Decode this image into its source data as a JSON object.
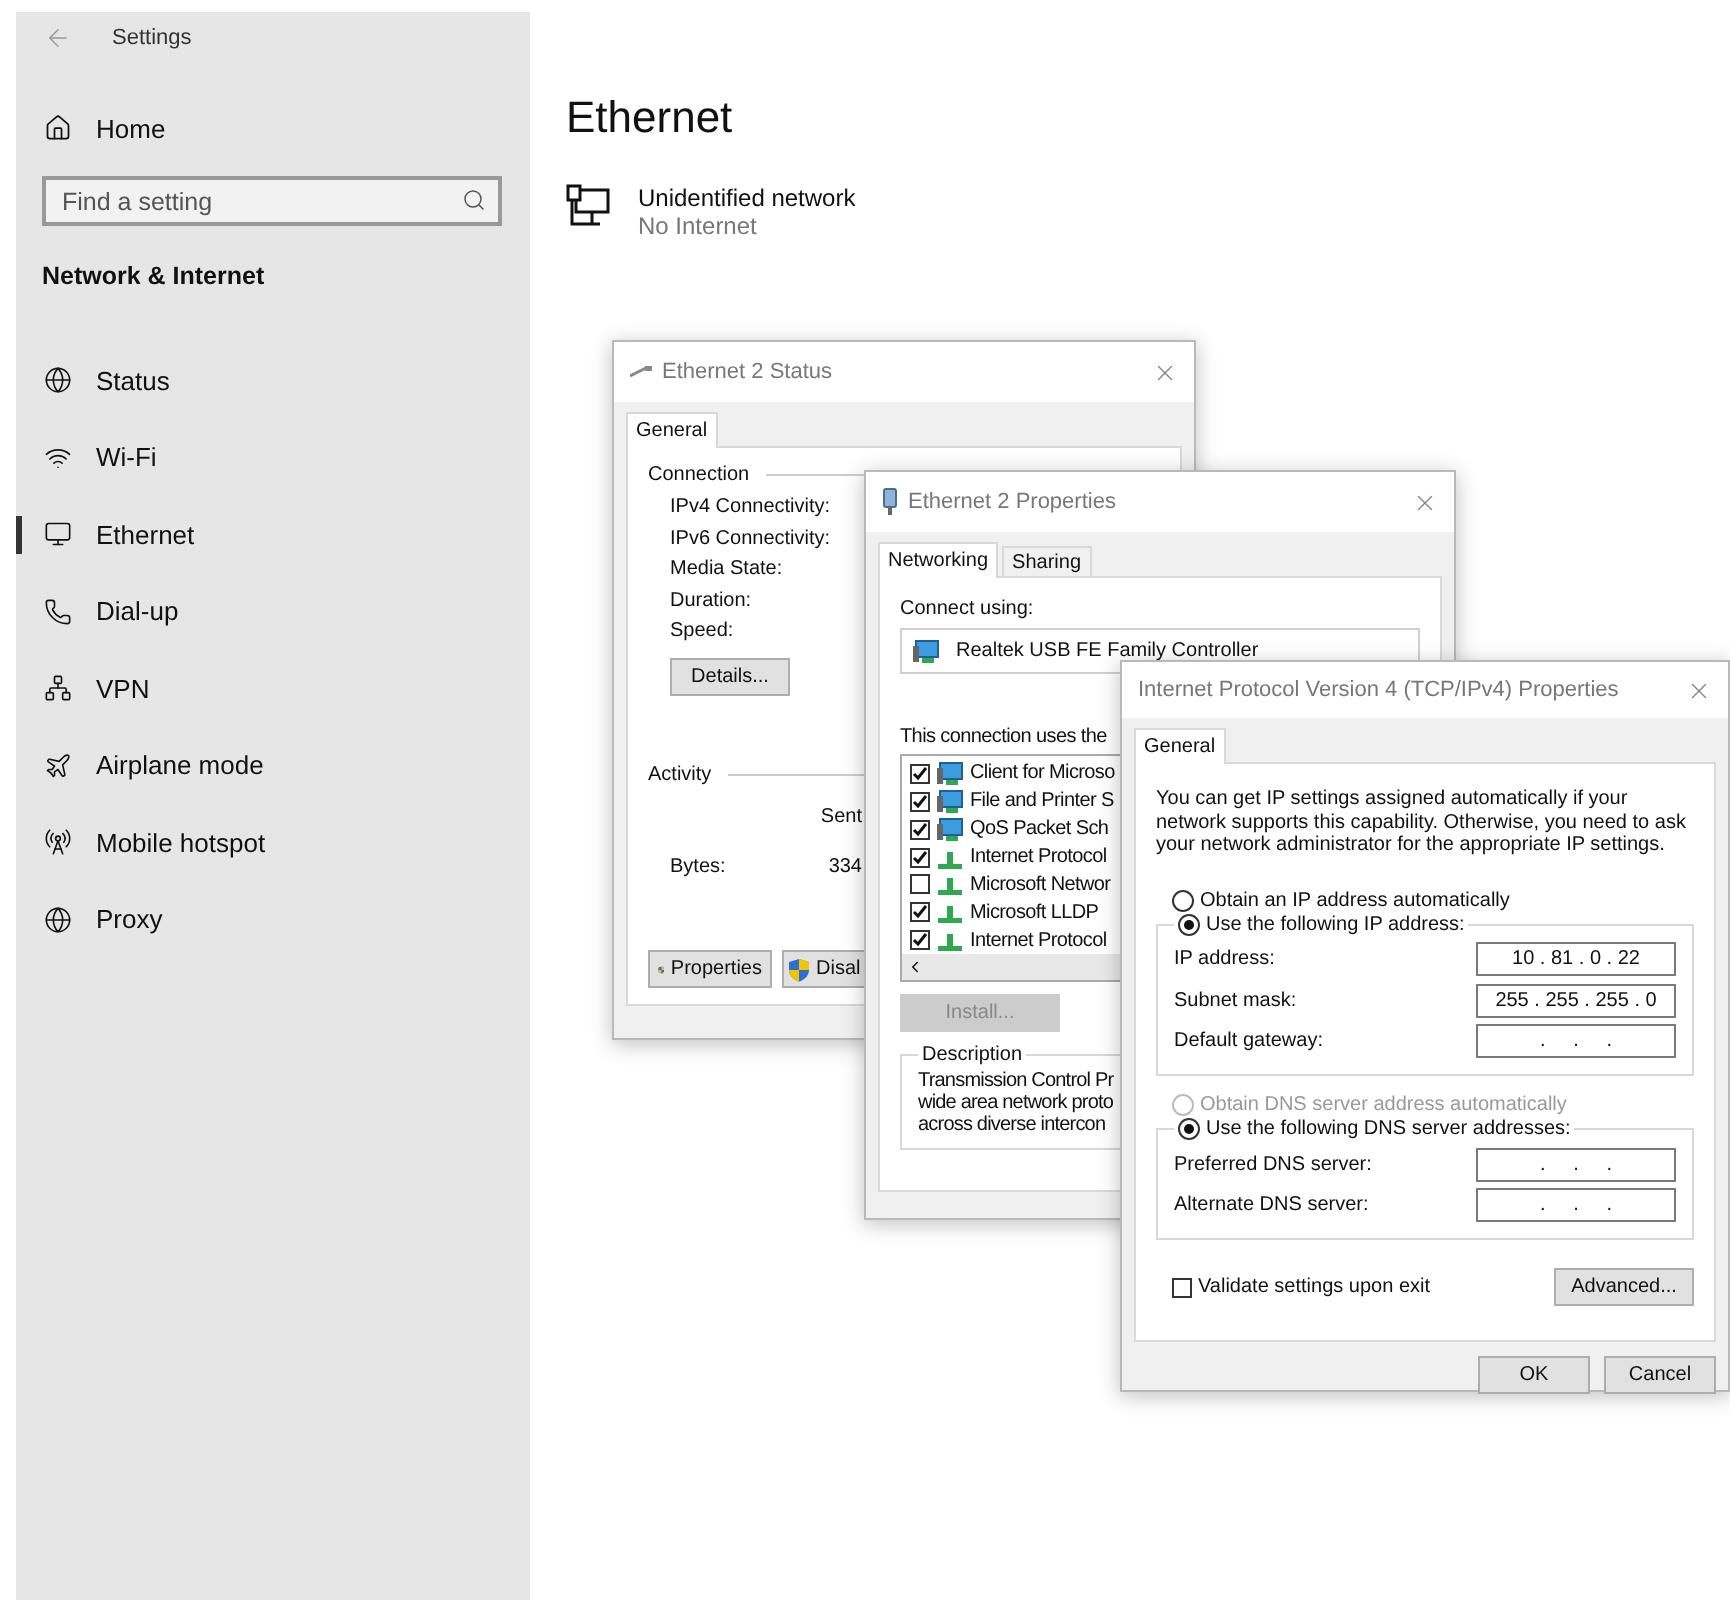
{
  "sidebar": {
    "title": "Settings",
    "home": "Home",
    "search": {
      "placeholder": "Find a setting"
    },
    "section": "Network & Internet",
    "items": [
      {
        "label": "Status",
        "selected": false
      },
      {
        "label": "Wi-Fi",
        "selected": false
      },
      {
        "label": "Ethernet",
        "selected": true
      },
      {
        "label": "Dial-up",
        "selected": false
      },
      {
        "label": "VPN",
        "selected": false
      },
      {
        "label": "Airplane mode",
        "selected": false
      },
      {
        "label": "Mobile hotspot",
        "selected": false
      },
      {
        "label": "Proxy",
        "selected": false
      }
    ]
  },
  "page": {
    "title": "Ethernet",
    "network": {
      "name": "Unidentified network",
      "status": "No Internet"
    }
  },
  "status_window": {
    "title": "Ethernet 2 Status",
    "tabs": [
      {
        "label": "General",
        "selected": true
      }
    ],
    "connection": {
      "heading": "Connection",
      "rows": [
        "IPv4 Connectivity:",
        "IPv6 Connectivity:",
        "Media State:",
        "Duration:",
        "Speed:"
      ]
    },
    "details_button": "Details...",
    "activity": {
      "heading": "Activity",
      "sent": "Sent",
      "bytes_label": "Bytes:",
      "bytes_sent": "334"
    },
    "buttons": [
      "Properties",
      "Disal"
    ]
  },
  "properties_window": {
    "title": "Ethernet 2 Properties",
    "tabs": [
      {
        "label": "Networking",
        "selected": true
      },
      {
        "label": "Sharing",
        "selected": false
      }
    ],
    "connect_using": "Connect using:",
    "adapter": "Realtek USB FE Family Controller",
    "items_label": "This connection uses the",
    "items": [
      {
        "label": "Client for Microso",
        "checked": true,
        "kind": "service"
      },
      {
        "label": "File and Printer S",
        "checked": true,
        "kind": "service"
      },
      {
        "label": "QoS Packet Sch",
        "checked": true,
        "kind": "service"
      },
      {
        "label": "Internet Protocol",
        "checked": true,
        "kind": "protocol"
      },
      {
        "label": "Microsoft Networ",
        "checked": false,
        "kind": "protocol"
      },
      {
        "label": "Microsoft LLDP",
        "checked": true,
        "kind": "protocol"
      },
      {
        "label": "Internet Protocol",
        "checked": true,
        "kind": "protocol"
      }
    ],
    "install_button": {
      "label": "Install...",
      "disabled": true
    },
    "description": {
      "heading": "Description",
      "lines": [
        "Transmission Control Pr",
        "wide area network proto",
        "across diverse intercon"
      ]
    }
  },
  "ipv4_window": {
    "title": "Internet Protocol Version 4 (TCP/IPv4) Properties",
    "tabs": [
      {
        "label": "General",
        "selected": true
      }
    ],
    "intro": "You can get IP settings assigned automatically if your network supports this capability. Otherwise, you need to ask your network administrator for the appropriate IP settings.",
    "ip_mode": [
      {
        "label": "Obtain an IP address automatically",
        "selected": false,
        "disabled": false
      },
      {
        "label": "Use the following IP address:",
        "selected": true,
        "disabled": false
      }
    ],
    "ip_fields": [
      {
        "label": "IP address:",
        "value": "10 . 81 . 0 . 22"
      },
      {
        "label": "Subnet mask:",
        "value": "255 . 255 . 255 . 0"
      },
      {
        "label": "Default gateway:",
        "value": ".     .     ."
      }
    ],
    "dns_mode": [
      {
        "label": "Obtain DNS server address automatically",
        "selected": false,
        "disabled": true
      },
      {
        "label": "Use the following DNS server addresses:",
        "selected": true,
        "disabled": false
      }
    ],
    "dns_fields": [
      {
        "label": "Preferred DNS server:",
        "value": ".     .     ."
      },
      {
        "label": "Alternate DNS server:",
        "value": ".     .     ."
      }
    ],
    "validate": {
      "label": "Validate settings upon exit",
      "checked": false
    },
    "advanced_button": "Advanced...",
    "buttons": [
      "OK",
      "Cancel"
    ]
  }
}
